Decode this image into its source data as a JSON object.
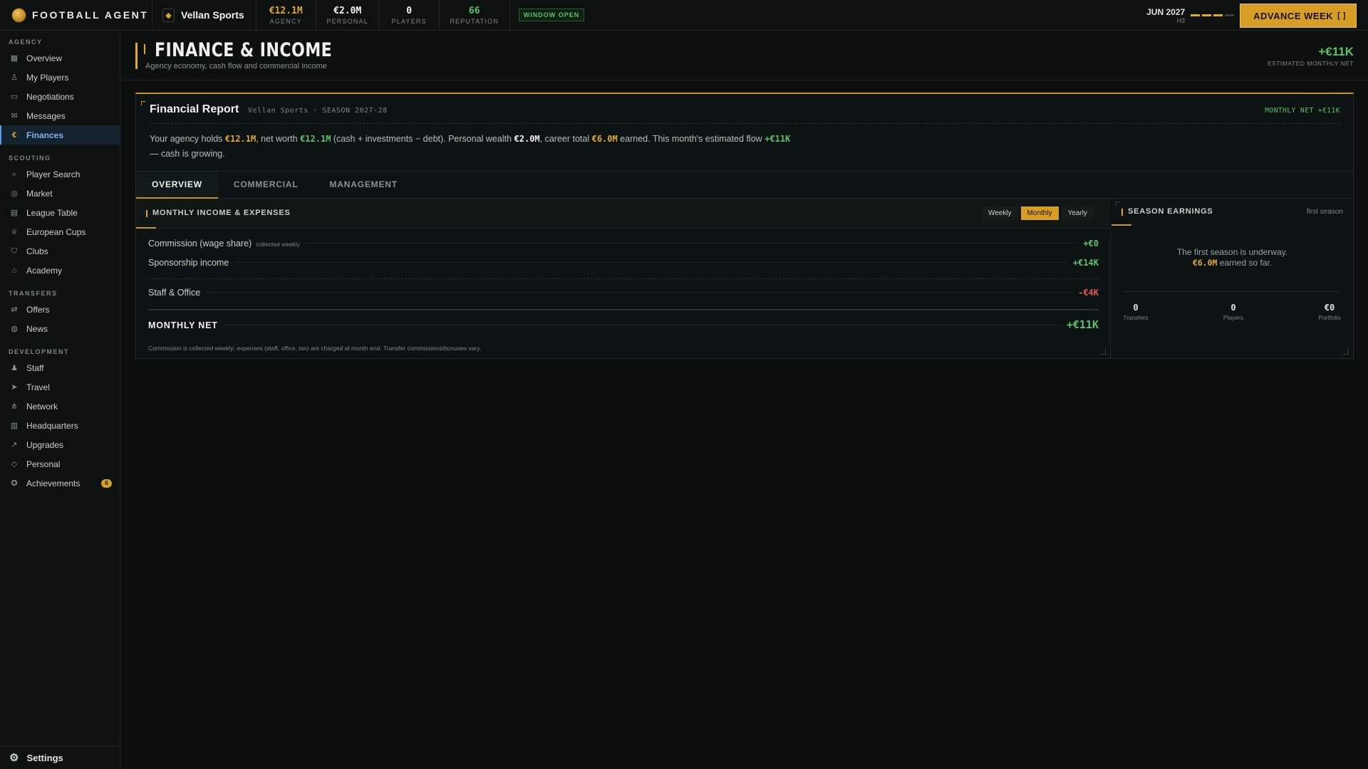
{
  "brand": "FOOTBALL AGENT",
  "agency_name": "Vellan Sports",
  "stats": [
    {
      "value": "€12.1M",
      "label": "AGENCY",
      "color": "#e0a82e"
    },
    {
      "value": "€2.0M",
      "label": "PERSONAL",
      "color": "#eef2ef"
    },
    {
      "value": "0",
      "label": "PLAYERS",
      "color": "#eef2ef"
    },
    {
      "value": "66",
      "label": "REPUTATION",
      "color": "#5fc06a"
    }
  ],
  "window_badge": "WINDOW OPEN",
  "date": {
    "month": "JUN 2027",
    "half": "H3"
  },
  "week_progress": {
    "filled": 3,
    "total": 4
  },
  "advance_label": "ADVANCE WEEK",
  "sidebar": {
    "sections": [
      {
        "title": "AGENCY",
        "items": [
          {
            "label": "Overview",
            "icon": "grid-icon"
          },
          {
            "label": "My Players",
            "icon": "user-icon"
          },
          {
            "label": "Negotiations",
            "icon": "chat-icon"
          },
          {
            "label": "Messages",
            "icon": "mail-icon"
          },
          {
            "label": "Finances",
            "icon": "euro-icon",
            "active": true
          }
        ]
      },
      {
        "title": "SCOUTING",
        "items": [
          {
            "label": "Player Search",
            "icon": "search-icon"
          },
          {
            "label": "Market",
            "icon": "broadcast-icon"
          },
          {
            "label": "League Table",
            "icon": "table-icon"
          },
          {
            "label": "European Cups",
            "icon": "trophy-icon"
          },
          {
            "label": "Clubs",
            "icon": "shield-icon"
          },
          {
            "label": "Academy",
            "icon": "graduation-icon"
          }
        ]
      },
      {
        "title": "TRANSFERS",
        "items": [
          {
            "label": "Offers",
            "icon": "swap-icon"
          },
          {
            "label": "News",
            "icon": "globe-icon"
          }
        ]
      },
      {
        "title": "DEVELOPMENT",
        "items": [
          {
            "label": "Staff",
            "icon": "team-icon"
          },
          {
            "label": "Travel",
            "icon": "plane-icon"
          },
          {
            "label": "Network",
            "icon": "network-icon"
          },
          {
            "label": "Headquarters",
            "icon": "building-icon"
          },
          {
            "label": "Upgrades",
            "icon": "trend-icon"
          },
          {
            "label": "Personal",
            "icon": "gem-icon"
          },
          {
            "label": "Achievements",
            "icon": "medal-icon",
            "badge": "6"
          }
        ]
      }
    ],
    "settings_label": "Settings"
  },
  "page": {
    "title": "FINANCE & INCOME",
    "subtitle": "Agency economy, cash flow and commercial income",
    "net_value": "+€11K",
    "net_label": "ESTIMATED MONTHLY NET"
  },
  "report": {
    "title": "Financial Report",
    "subtitle": "Vellan Sports · SEASON 2027-28",
    "monthly_net_tag": "MONTHLY NET +€11K",
    "summary": {
      "p1": "Your agency holds ",
      "agency": "€12.1M",
      "p2": ", net worth ",
      "networth": "€12.1M",
      "p3": " (cash + investments − debt). Personal wealth ",
      "personal": "€2.0M",
      "p4": ", career total ",
      "career": "€6.0M",
      "p5": " earned. This month's estimated flow ",
      "flow": "+€11K",
      "p6": " — cash is growing."
    },
    "tabs": [
      "OVERVIEW",
      "COMMERCIAL",
      "MANAGEMENT"
    ],
    "income": {
      "title": "MONTHLY INCOME & EXPENSES",
      "periods": [
        "Weekly",
        "Monthly",
        "Yearly"
      ],
      "rows": [
        {
          "name": "Commission (wage share)",
          "note": "collected weekly",
          "value": "+€0"
        },
        {
          "name": "Sponsorship income",
          "value": "+€14K"
        },
        {
          "name": "Staff & Office",
          "value": "-€4K"
        }
      ],
      "total_label": "MONTHLY NET",
      "total_value": "+€11K",
      "footnote": "Commission is collected weekly; expenses (staff, office, tax) are charged at month end. Transfer commissions/bonuses vary."
    },
    "season": {
      "title": "SEASON EARNINGS",
      "sub": "first season",
      "msg1": "The first season is underway.",
      "msg_value": "€6.0M",
      "msg2": " earned so far.",
      "stats": [
        {
          "value": "0",
          "label": "Transfers"
        },
        {
          "value": "0",
          "label": "Players"
        },
        {
          "value": "€0",
          "label": "Portfolio"
        }
      ]
    }
  }
}
